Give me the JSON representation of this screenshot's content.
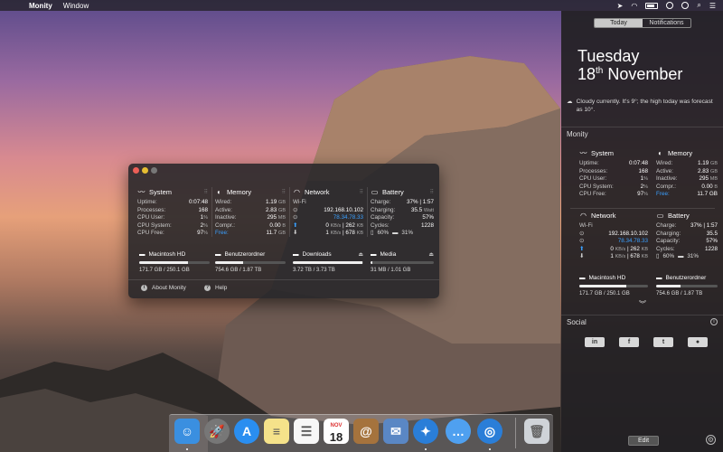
{
  "menubar": {
    "app_name": "Monity",
    "menu_window": "Window"
  },
  "window": {
    "system": {
      "title": "System",
      "rows": [
        {
          "k": "Uptime:",
          "v": "0:07:48",
          "u": ""
        },
        {
          "k": "Processes:",
          "v": "168",
          "u": ""
        },
        {
          "k": "CPU User:",
          "v": "1",
          "u": "%"
        },
        {
          "k": "CPU System:",
          "v": "2",
          "u": "%"
        },
        {
          "k": "CPU Free:",
          "v": "97",
          "u": "%"
        }
      ]
    },
    "memory": {
      "title": "Memory",
      "rows": [
        {
          "k": "Wired:",
          "v": "1.19",
          "u": "GB"
        },
        {
          "k": "Active:",
          "v": "2.83",
          "u": "GB"
        },
        {
          "k": "Inactive:",
          "v": "295",
          "u": "MB"
        },
        {
          "k": "Compr.:",
          "v": "0.00",
          "u": "B"
        },
        {
          "k": "Free:",
          "v": "11.7",
          "u": "GB"
        }
      ]
    },
    "network": {
      "title": "Network",
      "interface": "Wi-Fi",
      "local_ip": "192.168.10.102",
      "public_ip": "78.34.78.33",
      "up_rate": "0",
      "up_unit": "KB/s",
      "up_total": "262",
      "up_total_unit": "KB",
      "down_rate": "1",
      "down_unit": "KB/s",
      "down_total": "678",
      "down_total_unit": "KB"
    },
    "battery": {
      "title": "Battery",
      "charge_label": "Charge:",
      "charge": "37%",
      "charge_time": "1:57",
      "charging_label": "Charging:",
      "charging": "35.5",
      "charging_unit": "Watt",
      "capacity_label": "Capacity:",
      "capacity": "57%",
      "cycles_label": "Cycles:",
      "cycles": "1228",
      "bt_level": "60%",
      "kb_level": "31%"
    },
    "disks": [
      {
        "name": "Macintosh HD",
        "size": "171.7 GB / 250.1 GB",
        "used_fraction": 0.69
      },
      {
        "name": "Benutzerordner",
        "size": "754.6 GB / 1.87 TB",
        "used_fraction": 0.4
      },
      {
        "name": "Downloads",
        "size": "3.72 TB / 3.73 TB",
        "used_fraction": 0.99
      },
      {
        "name": "Media",
        "size": "31 MB / 1.01 GB",
        "used_fraction": 0.03
      }
    ],
    "about_label": "About Monity",
    "help_label": "Help"
  },
  "notification_center": {
    "tab_today": "Today",
    "tab_notifications": "Notifications",
    "day": "Tuesday",
    "date_num": "18",
    "date_suffix": "th",
    "month": "November",
    "weather": "Cloudy currently. It's 9°; the high today was forecast as 10°.",
    "monity_label": "Monity",
    "social_label": "Social",
    "edit_label": "Edit",
    "memory_free": "11.7 GB"
  },
  "dock": {
    "calendar_month": "NOV",
    "calendar_day": "18"
  },
  "colors": {
    "accent_blue": "#3aa0ff",
    "close": "#ec5f57",
    "minimize": "#e6bd32"
  }
}
